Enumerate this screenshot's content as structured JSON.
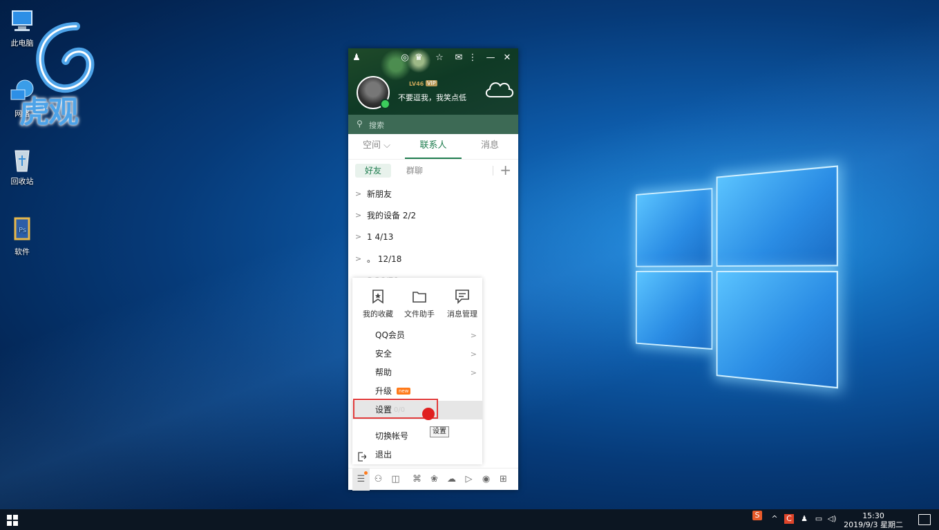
{
  "desktop": {
    "icons": [
      {
        "label": "此电脑",
        "icon": "computer-icon"
      },
      {
        "label": "网络",
        "icon": "network-icon"
      },
      {
        "label": "回收站",
        "icon": "recycle-bin-icon"
      },
      {
        "label": "软件",
        "icon": "folder-icon"
      }
    ],
    "watermark": "虎观"
  },
  "qq": {
    "header": {
      "level_badge": "LV46",
      "vip_badge": "VIP",
      "signature": "不要逗我，我笑点低",
      "icons": [
        "penguin-icon",
        "skin-icon",
        "medal-icon",
        "star-icon",
        "mail-icon",
        "more-icon",
        "minimize-icon",
        "close-icon"
      ]
    },
    "search": {
      "placeholder": "搜索"
    },
    "tabs": [
      {
        "label": "空间 ⌵",
        "active": false
      },
      {
        "label": "联系人",
        "active": true
      },
      {
        "label": "消息",
        "active": false
      }
    ],
    "subtabs": [
      {
        "label": "好友",
        "active": true
      },
      {
        "label": "群聊",
        "active": false
      }
    ],
    "groups": [
      {
        "label": "新朋友"
      },
      {
        "label": "我的设备  2/2"
      },
      {
        "label": "1  4/13"
      },
      {
        "label": "。  12/18"
      },
      {
        "label": "S  36/70"
      }
    ],
    "menu": {
      "quick": [
        {
          "label": "我的收藏",
          "icon": "bookmark-star-icon"
        },
        {
          "label": "文件助手",
          "icon": "folder-icon"
        },
        {
          "label": "消息管理",
          "icon": "message-icon"
        }
      ],
      "items": [
        {
          "label": "QQ会员",
          "submenu": true
        },
        {
          "label": "安全",
          "submenu": true
        },
        {
          "label": "帮助",
          "submenu": true
        },
        {
          "label": "升级",
          "badge": "new"
        },
        {
          "label": "设置",
          "hover": true,
          "faded_suffix": "0/0"
        },
        {
          "label": "切换帐号"
        },
        {
          "label": "退出",
          "icon": "exit-icon"
        }
      ],
      "tooltip": "设置"
    },
    "bottom_icons": [
      "menu-icon",
      "add-friend-icon",
      "apps-icon",
      "map-icon",
      "pet-icon",
      "weiyun-icon",
      "video-icon",
      "music-icon",
      "grid-icon"
    ]
  },
  "taskbar": {
    "time": "15:30",
    "date": "2019/9/3 星期二",
    "tray_icons": [
      "sogou-icon",
      "chevron-up-icon",
      "app-icon",
      "qq-penguin-icon",
      "network-icon",
      "volume-icon"
    ]
  },
  "colors": {
    "qq_green": "#1f7d4f",
    "highlight_red": "#e23b3b",
    "new_badge": "#ff7a1a"
  }
}
